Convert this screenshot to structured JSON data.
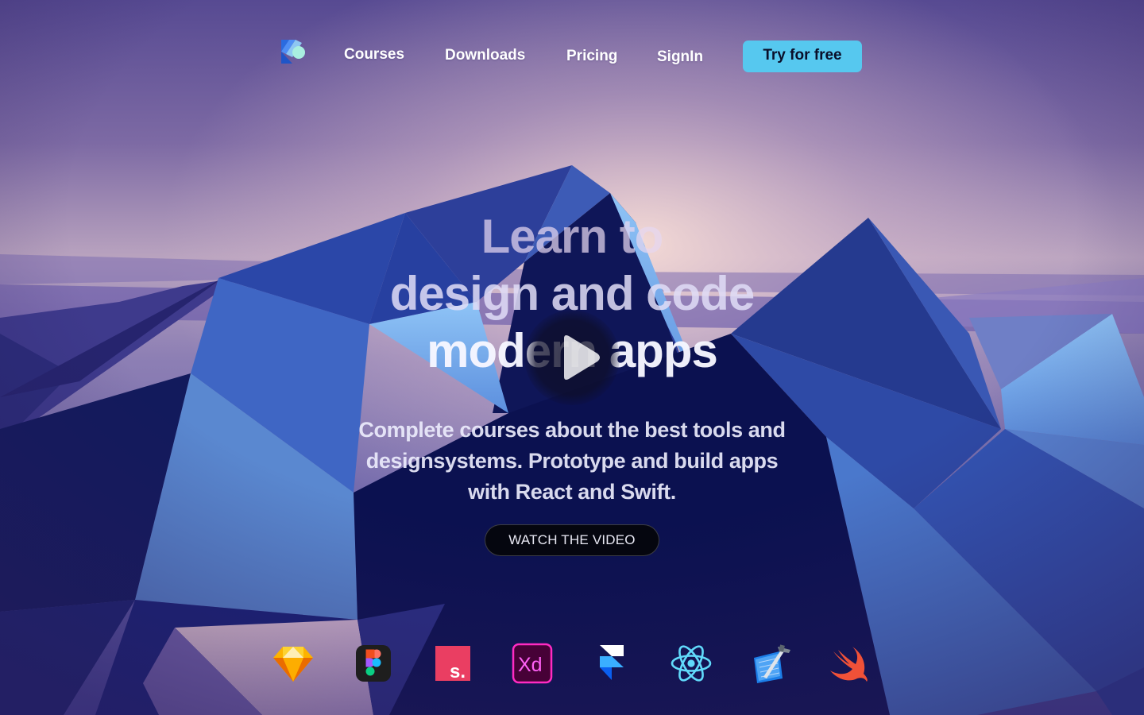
{
  "nav": {
    "logo_icon": "brand-logo-icon",
    "links": [
      {
        "label": "Courses"
      },
      {
        "label": "Downloads"
      },
      {
        "label": "Pricing"
      },
      {
        "label": "SignIn"
      }
    ],
    "cta_label": "Try for free"
  },
  "hero": {
    "title_lines": [
      "Learn to",
      "design and code",
      "modern apps"
    ],
    "play_icon": "play-icon",
    "subtitle": "Complete courses about the best tools and designsystems. Prototype and build apps with React and Swift.",
    "watch_label": "WATCH THE VIDEO"
  },
  "tools": [
    {
      "icon": "sketch-icon"
    },
    {
      "icon": "figma-icon"
    },
    {
      "icon": "studio-icon",
      "text": "s."
    },
    {
      "icon": "adobe-xd-icon",
      "text": "Xd"
    },
    {
      "icon": "framer-icon"
    },
    {
      "icon": "react-icon"
    },
    {
      "icon": "xcode-icon"
    },
    {
      "icon": "swift-icon"
    }
  ],
  "colors": {
    "accent": "#56c8ef",
    "night": "#0d1240",
    "sky_top": "#5a4d96",
    "sky_glow": "#f1d6d4"
  }
}
